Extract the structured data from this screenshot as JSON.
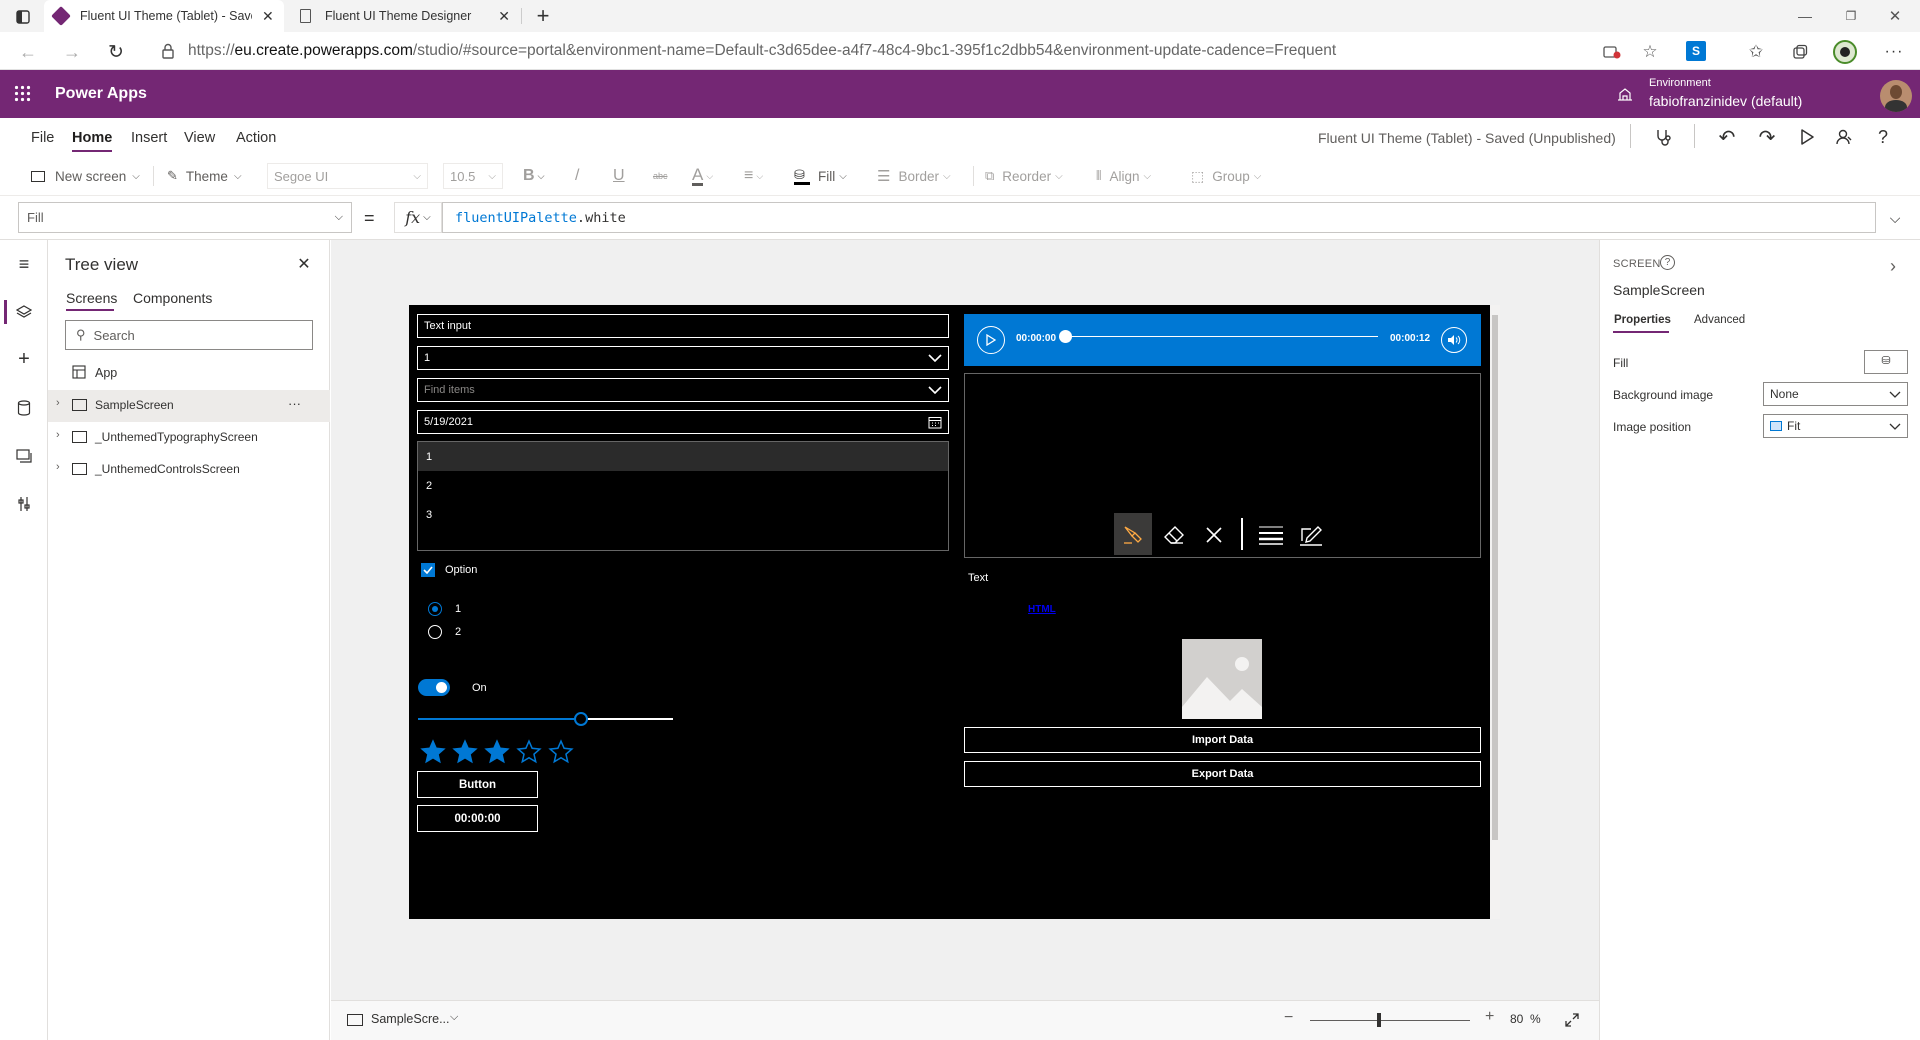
{
  "browser": {
    "tabs": [
      {
        "title": "Fluent UI Theme (Tablet) - Saved"
      },
      {
        "title": "Fluent UI Theme Designer"
      }
    ],
    "url_prefix": "https://",
    "url_host": "eu.create.powerapps.com",
    "url_rest": "/studio/#source=portal&environment-name=Default-c3d65dee-a4f7-48c4-9bc1-395f1c2dbb54&environment-update-cadence=Frequent"
  },
  "app_header": {
    "title": "Power Apps",
    "environment_label": "Environment",
    "environment_name": "fabiofranzinidev (default)",
    "color": "#742774"
  },
  "menu": {
    "items": [
      "File",
      "Home",
      "Insert",
      "View",
      "Action"
    ],
    "active": "Home",
    "doc_title": "Fluent UI Theme (Tablet) - Saved (Unpublished)"
  },
  "ribbon": {
    "new_screen": "New screen",
    "theme": "Theme",
    "font": "Segoe UI",
    "font_size": "10.5",
    "bold": "B",
    "italic": "/",
    "underline": "U",
    "strikethrough": "abc",
    "font_color": "A",
    "fill": "Fill",
    "border": "Border",
    "reorder": "Reorder",
    "align": "Align",
    "group": "Group"
  },
  "formula": {
    "property": "Fill",
    "equals": "=",
    "fx": "fx",
    "obj": "fluentUIPalette",
    "dot": ".",
    "member": "white"
  },
  "tree": {
    "title": "Tree view",
    "tabs": [
      "Screens",
      "Components"
    ],
    "search_placeholder": "Search",
    "app_item": "App",
    "screens": [
      "SampleScreen",
      "_UnthemedTypographyScreen",
      "_UnthemedControlsScreen"
    ],
    "more": "···"
  },
  "canvas": {
    "text_input": "Text input",
    "dropdown_value": "1",
    "combobox_placeholder": "Find items",
    "date": "5/19/2021",
    "list_items": [
      "1",
      "2",
      "3"
    ],
    "checkbox_label": "Option",
    "radio_options": [
      "1",
      "2"
    ],
    "toggle_label": "On",
    "slider_value": 0.64,
    "rating_value": 3,
    "rating_max": 5,
    "button_label": "Button",
    "timer_label": "00:00:00",
    "audio_start": "00:00:00",
    "audio_end": "00:00:12",
    "text_label": "Text",
    "html_label": "HTML",
    "import_label": "Import Data",
    "export_label": "Export Data",
    "accent": "#0078d4"
  },
  "status": {
    "screen": "SampleScre...",
    "zoom_value": "80",
    "zoom_unit": "%",
    "minus": "−",
    "plus": "+"
  },
  "props": {
    "type_label": "SCREEN",
    "screen_name": "SampleScreen",
    "tabs": [
      "Properties",
      "Advanced"
    ],
    "fill_label": "Fill",
    "bg_image_label": "Background image",
    "bg_image_value": "None",
    "img_pos_label": "Image position",
    "img_pos_value": "Fit"
  }
}
